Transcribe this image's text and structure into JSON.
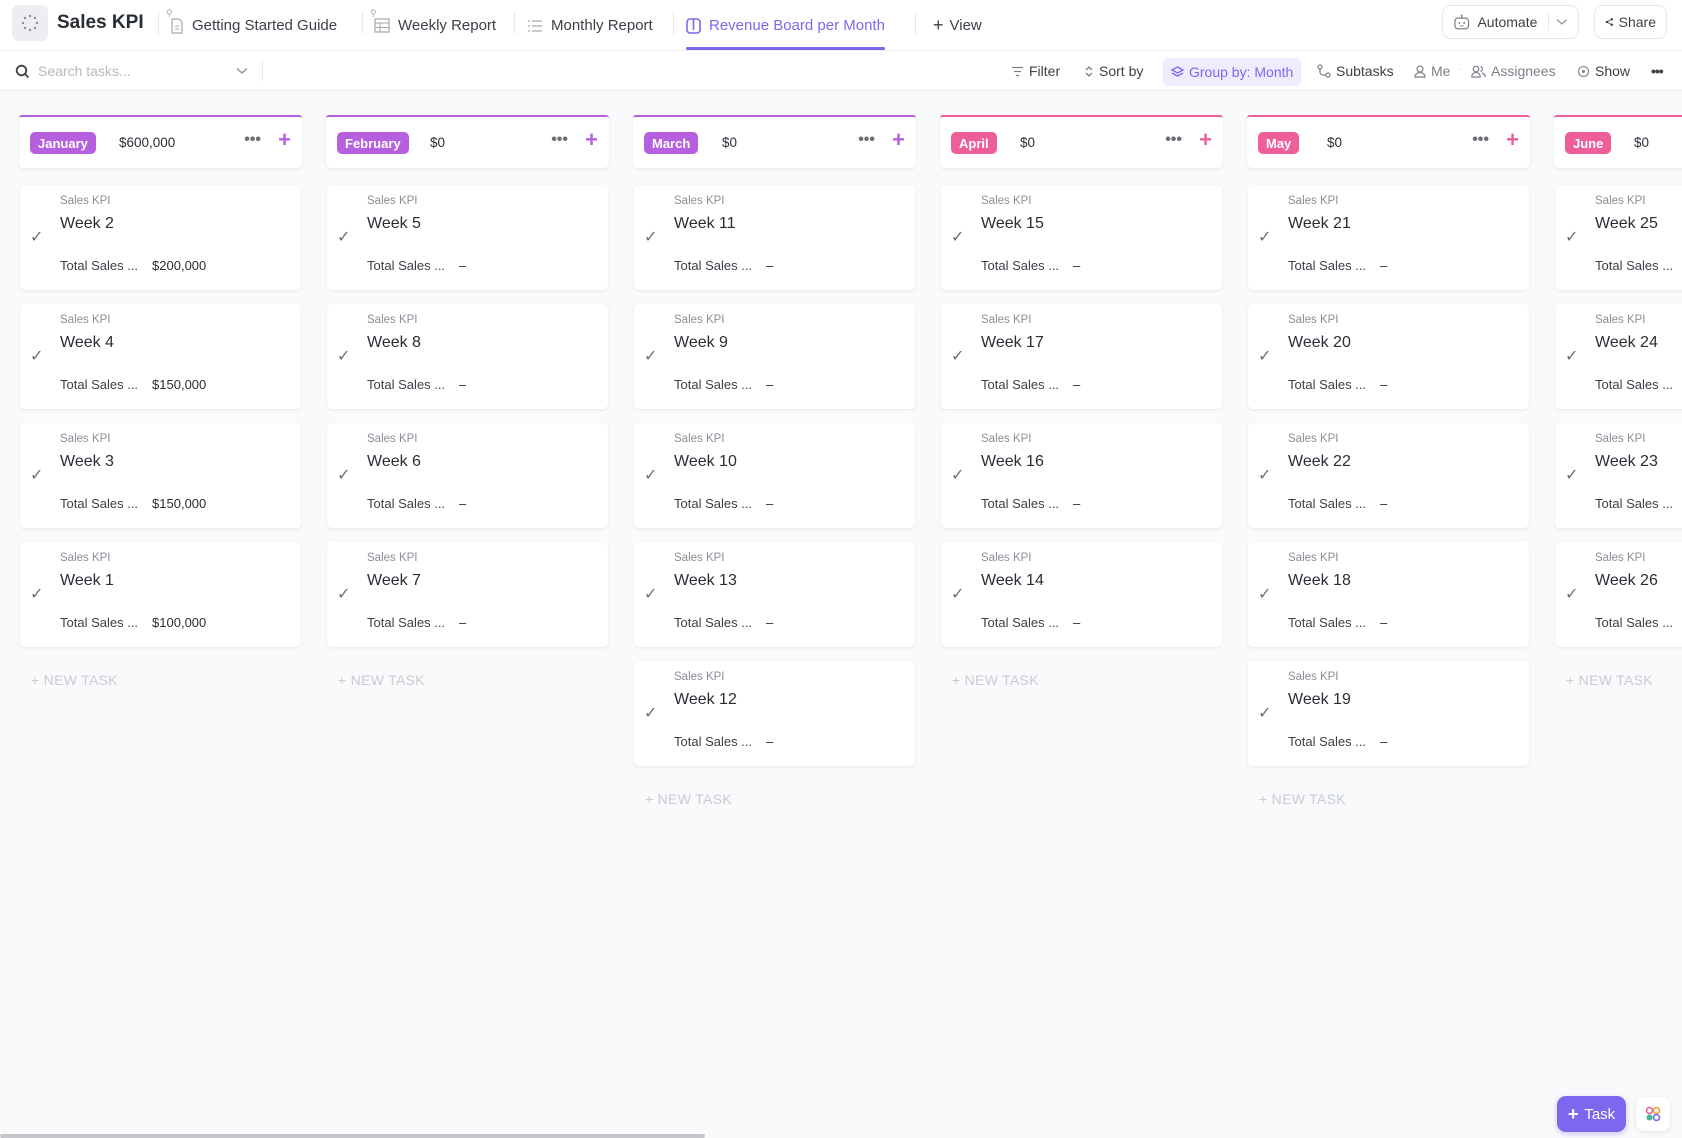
{
  "app": {
    "space_title": "Sales KPI"
  },
  "tabs": [
    {
      "label": "Getting Started Guide",
      "icon": "doc-icon",
      "pinned": true
    },
    {
      "label": "Weekly Report",
      "icon": "table-icon",
      "pinned": true
    },
    {
      "label": "Monthly Report",
      "icon": "list-icon",
      "pinned": false
    },
    {
      "label": "Revenue Board per Month",
      "icon": "board-icon",
      "active": true
    }
  ],
  "add_view_label": "View",
  "header_actions": {
    "automate_label": "Automate",
    "share_label": "Share"
  },
  "toolbar": {
    "search_placeholder": "Search tasks...",
    "filter_label": "Filter",
    "sort_label": "Sort by",
    "group_label": "Group by: Month",
    "subtasks_label": "Subtasks",
    "me_label": "Me",
    "assignees_label": "Assignees",
    "show_label": "Show"
  },
  "columns": [
    {
      "name": "January",
      "total": "$600,000",
      "color": "#b660e0",
      "cards": [
        {
          "list": "Sales KPI",
          "title": "Week 2",
          "field_label": "Total Sales ...",
          "field_value": "$200,000"
        },
        {
          "list": "Sales KPI",
          "title": "Week 4",
          "field_label": "Total Sales ...",
          "field_value": "$150,000"
        },
        {
          "list": "Sales KPI",
          "title": "Week 3",
          "field_label": "Total Sales ...",
          "field_value": "$150,000"
        },
        {
          "list": "Sales KPI",
          "title": "Week 1",
          "field_label": "Total Sales ...",
          "field_value": "$100,000"
        }
      ]
    },
    {
      "name": "February",
      "total": "$0",
      "color": "#b660e0",
      "cards": [
        {
          "list": "Sales KPI",
          "title": "Week 5",
          "field_label": "Total Sales ...",
          "field_value": "–"
        },
        {
          "list": "Sales KPI",
          "title": "Week 8",
          "field_label": "Total Sales ...",
          "field_value": "–"
        },
        {
          "list": "Sales KPI",
          "title": "Week 6",
          "field_label": "Total Sales ...",
          "field_value": "–"
        },
        {
          "list": "Sales KPI",
          "title": "Week 7",
          "field_label": "Total Sales ...",
          "field_value": "–"
        }
      ]
    },
    {
      "name": "March",
      "total": "$0",
      "color": "#b660e0",
      "cards": [
        {
          "list": "Sales KPI",
          "title": "Week 11",
          "field_label": "Total Sales ...",
          "field_value": "–"
        },
        {
          "list": "Sales KPI",
          "title": "Week 9",
          "field_label": "Total Sales ...",
          "field_value": "–"
        },
        {
          "list": "Sales KPI",
          "title": "Week 10",
          "field_label": "Total Sales ...",
          "field_value": "–"
        },
        {
          "list": "Sales KPI",
          "title": "Week 13",
          "field_label": "Total Sales ...",
          "field_value": "–"
        },
        {
          "list": "Sales KPI",
          "title": "Week 12",
          "field_label": "Total Sales ...",
          "field_value": "–"
        }
      ]
    },
    {
      "name": "April",
      "total": "$0",
      "color": "#ee5e99",
      "cards": [
        {
          "list": "Sales KPI",
          "title": "Week 15",
          "field_label": "Total Sales ...",
          "field_value": "–"
        },
        {
          "list": "Sales KPI",
          "title": "Week 17",
          "field_label": "Total Sales ...",
          "field_value": "–"
        },
        {
          "list": "Sales KPI",
          "title": "Week 16",
          "field_label": "Total Sales ...",
          "field_value": "–"
        },
        {
          "list": "Sales KPI",
          "title": "Week 14",
          "field_label": "Total Sales ...",
          "field_value": "–"
        }
      ]
    },
    {
      "name": "May",
      "total": "$0",
      "color": "#ee5e99",
      "cards": [
        {
          "list": "Sales KPI",
          "title": "Week 21",
          "field_label": "Total Sales ...",
          "field_value": "–"
        },
        {
          "list": "Sales KPI",
          "title": "Week 20",
          "field_label": "Total Sales ...",
          "field_value": "–"
        },
        {
          "list": "Sales KPI",
          "title": "Week 22",
          "field_label": "Total Sales ...",
          "field_value": "–"
        },
        {
          "list": "Sales KPI",
          "title": "Week 18",
          "field_label": "Total Sales ...",
          "field_value": "–"
        },
        {
          "list": "Sales KPI",
          "title": "Week 19",
          "field_label": "Total Sales ...",
          "field_value": "–"
        }
      ]
    },
    {
      "name": "June",
      "total": "$0",
      "color": "#ee5e99",
      "cards": [
        {
          "list": "Sales KPI",
          "title": "Week 25",
          "field_label": "Total Sales ...",
          "field_value": ""
        },
        {
          "list": "Sales KPI",
          "title": "Week 24",
          "field_label": "Total Sales ...",
          "field_value": ""
        },
        {
          "list": "Sales KPI",
          "title": "Week 23",
          "field_label": "Total Sales ...",
          "field_value": ""
        },
        {
          "list": "Sales KPI",
          "title": "Week 26",
          "field_label": "Total Sales ...",
          "field_value": ""
        }
      ]
    }
  ],
  "new_task_label": "+ NEW TASK",
  "fab": {
    "task_label": "Task"
  }
}
